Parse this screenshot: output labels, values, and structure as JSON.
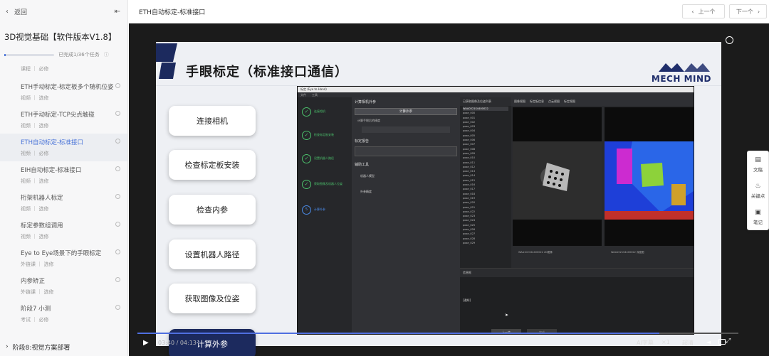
{
  "sidebar": {
    "back_label": "返回",
    "collapse_icon": "collapse-icon",
    "course_title": "3D视觉基础【软件版本V1.8】",
    "progress": {
      "text": "已完成1/36个任务",
      "fraction": 0.0278
    },
    "lessons": [
      {
        "title": "",
        "meta": "课程 ｜ 必修"
      },
      {
        "title": "ETH手动标定-标定板多个随机位姿",
        "meta": "视频 ｜ 选修"
      },
      {
        "title": "ETH手动标定-TCP尖点触碰",
        "meta": "视频 ｜ 选修"
      },
      {
        "title": "ETH自动标定-标准接口",
        "meta": "视频 ｜ 必修",
        "active": true
      },
      {
        "title": "EIH自动标定-标准接口",
        "meta": "视频 ｜ 选修"
      },
      {
        "title": "桁架机器人标定",
        "meta": "视频 ｜ 选修"
      },
      {
        "title": "标定参数组调用",
        "meta": "视频 ｜ 选修"
      },
      {
        "title": "Eye to Eye场景下的手眼标定",
        "meta": "外链课 ｜ 选修"
      },
      {
        "title": "内参矫正",
        "meta": "外链课 ｜ 选修"
      },
      {
        "title": "阶段7 小测",
        "meta": "考试 ｜ 必修"
      }
    ],
    "section_label": "阶段8:视觉方案部署"
  },
  "topbar": {
    "title": "ETH自动标定-标准接口",
    "prev_label": "上一个",
    "next_label": "下一个"
  },
  "slide": {
    "title": "手眼标定（标准接口通信）",
    "logo": "MECH MIND",
    "steps": [
      "连接相机",
      "检查标定板安装",
      "检查内参",
      "设置机器人路径",
      "获取图像及位姿",
      "计算外参"
    ]
  },
  "software": {
    "window_title": "标定 (Eye to Hand)",
    "menu": [
      "文件",
      "工具"
    ],
    "left_steps": [
      "连接相机",
      "检查标定板安装",
      "设置机器人路径",
      "获取图像及机器人位姿",
      "计算外参"
    ],
    "mid_header": "计算相机外参",
    "mid_button": "计算外参",
    "mid_check": "计算手眼后的精度",
    "mid_section2": "标定报告",
    "mid_section3": "辅助工具",
    "tool1": "机器人模型",
    "tool2": "外参精度",
    "list_header": "已获取图像及位姿列表",
    "list_items": [
      "WAA0521S4400022",
      "pose_000",
      "pose_001",
      "pose_002",
      "pose_003",
      "pose_004",
      "pose_005",
      "pose_006",
      "pose_007",
      "pose_008",
      "pose_009",
      "pose_010",
      "pose_011",
      "pose_012",
      "pose_013",
      "pose_014",
      "pose_015",
      "pose_016",
      "pose_017",
      "pose_018",
      "pose_019",
      "pose_020",
      "pose_021",
      "pose_022",
      "pose_023",
      "pose_024",
      "pose_025",
      "pose_026",
      "pose_027",
      "pose_028",
      "pose_029"
    ],
    "view_tabs": [
      "图像视图",
      "标定板信息",
      "点云视图",
      "标定视图"
    ],
    "image_label1": "WAA1021S4400022 2D图像",
    "image_label2": "WAA1021S4400022 深度图",
    "log_header": "信息框",
    "log_text": "[通知]",
    "prev_btn": "上一步",
    "next_btn": "完成"
  },
  "controls": {
    "time": "03:40 / 04:13",
    "progress_fraction": 0.869,
    "subtitle_label": "AI字幕",
    "speed_label": "×1",
    "quality_label": "超清"
  },
  "right_panel": [
    {
      "label": "文稿",
      "icon": "document-icon"
    },
    {
      "label": "关键点",
      "icon": "keypoint-icon"
    },
    {
      "label": "笔记",
      "icon": "note-icon"
    }
  ],
  "colors": {
    "accent": "#2b5cd6",
    "slide_dark_button": "#1c2a5e",
    "timeline": "#4f6fe0",
    "success": "#4bbf6b"
  }
}
